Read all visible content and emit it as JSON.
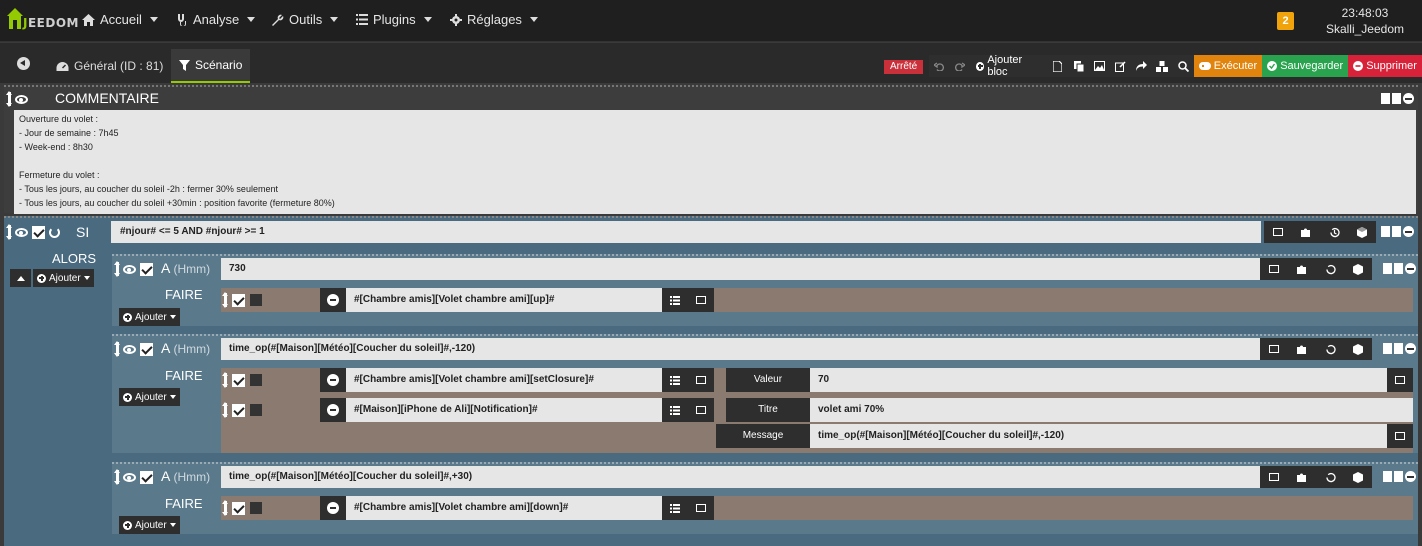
{
  "app": {
    "logo_text": "EEDOM",
    "logo_letter": "J"
  },
  "nav": {
    "accueil": "Accueil",
    "analyse": "Analyse",
    "outils": "Outils",
    "plugins": "Plugins",
    "reglages": "Réglages"
  },
  "notifications": {
    "count": "2"
  },
  "clock": {
    "time": "23:48:03",
    "user": "Skalli_Jeedom"
  },
  "tabs": {
    "general": "Général (ID : 81)",
    "scenario": "Scénario"
  },
  "toolbar": {
    "status": "Arrêté",
    "add_block": "Ajouter bloc",
    "execute": "Exécuter",
    "save": "Sauvegarder",
    "delete": "Supprimer"
  },
  "comment": {
    "title": "COMMENTAIRE",
    "lines": [
      "Ouverture du volet :",
      "- Jour de semaine : 7h45",
      "- Week-end : 8h30",
      "",
      "Fermeture du volet :",
      "- Tous les jours, au coucher du soleil -2h : fermer 30% seulement",
      "- Tous les jours, au coucher du soleil +30min : position favorite (fermeture 80%)"
    ]
  },
  "si": {
    "label": "SI",
    "condition": "#njour# <= 5 AND #njour# >= 1",
    "alors": "ALORS",
    "ajouter": "Ajouter"
  },
  "blocks": [
    {
      "label": "A",
      "unit": "(Hmm)",
      "value": "730",
      "faire": "FAIRE",
      "ajouter": "Ajouter",
      "actions": [
        {
          "cmd": "#[Chambre amis][Volet chambre ami][up]#"
        }
      ]
    },
    {
      "label": "A",
      "unit": "(Hmm)",
      "value": "time_op(#[Maison][Météo][Coucher du soleil]#,-120)",
      "faire": "FAIRE",
      "ajouter": "Ajouter",
      "actions": [
        {
          "cmd": "#[Chambre amis][Volet chambre ami][setClosure]#",
          "opt_label": "Valeur",
          "opt_value": "70"
        },
        {
          "cmd": "#[Maison][iPhone de Ali][Notification]#",
          "opt_label": "Titre",
          "opt_value": "volet ami 70%",
          "opt2_label": "Message",
          "opt2_value": "time_op(#[Maison][Météo][Coucher du soleil]#,-120)"
        }
      ]
    },
    {
      "label": "A",
      "unit": "(Hmm)",
      "value": "time_op(#[Maison][Météo][Coucher du soleil]#,+30)",
      "faire": "FAIRE",
      "ajouter": "Ajouter",
      "actions": [
        {
          "cmd": "#[Chambre amis][Volet chambre ami][down]#"
        }
      ]
    }
  ],
  "colors": {
    "accent": "#94ca02",
    "execute": "#e0840e",
    "save": "#2aa34f",
    "delete": "#d7223a",
    "badge": "#f0a30a"
  }
}
